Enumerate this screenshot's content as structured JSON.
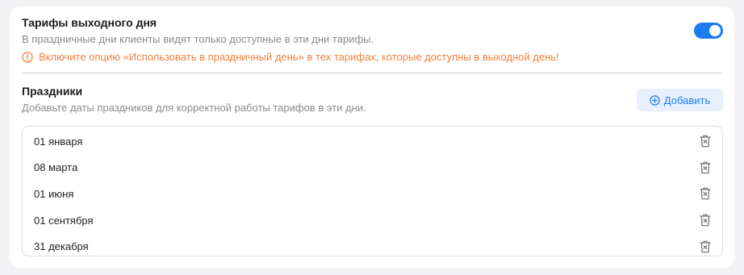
{
  "weekend": {
    "title": "Тарифы выходного дня",
    "subtitle": "В праздничные дни клиенты видят только доступные в эти дни тарифы.",
    "warning": "Включите опцию «Использовать в праздничный день» в тех тарифах, которые доступны в выходной день!",
    "toggle_on": true
  },
  "holidays": {
    "title": "Праздники",
    "subtitle": "Добавьте даты праздников для корректной работы тарифов в эти дни.",
    "add_label": "Добавить",
    "items": [
      {
        "label": "01 января"
      },
      {
        "label": "08 марта"
      },
      {
        "label": "01 июня"
      },
      {
        "label": "01 сентября"
      },
      {
        "label": "31 декабря"
      }
    ]
  },
  "colors": {
    "accent": "#1a7cf0",
    "warning": "#f0803c",
    "muted": "#8a8a8a"
  },
  "icons": {
    "warning": "warning-circle-icon",
    "add": "plus-circle-icon",
    "delete": "trash-icon"
  }
}
